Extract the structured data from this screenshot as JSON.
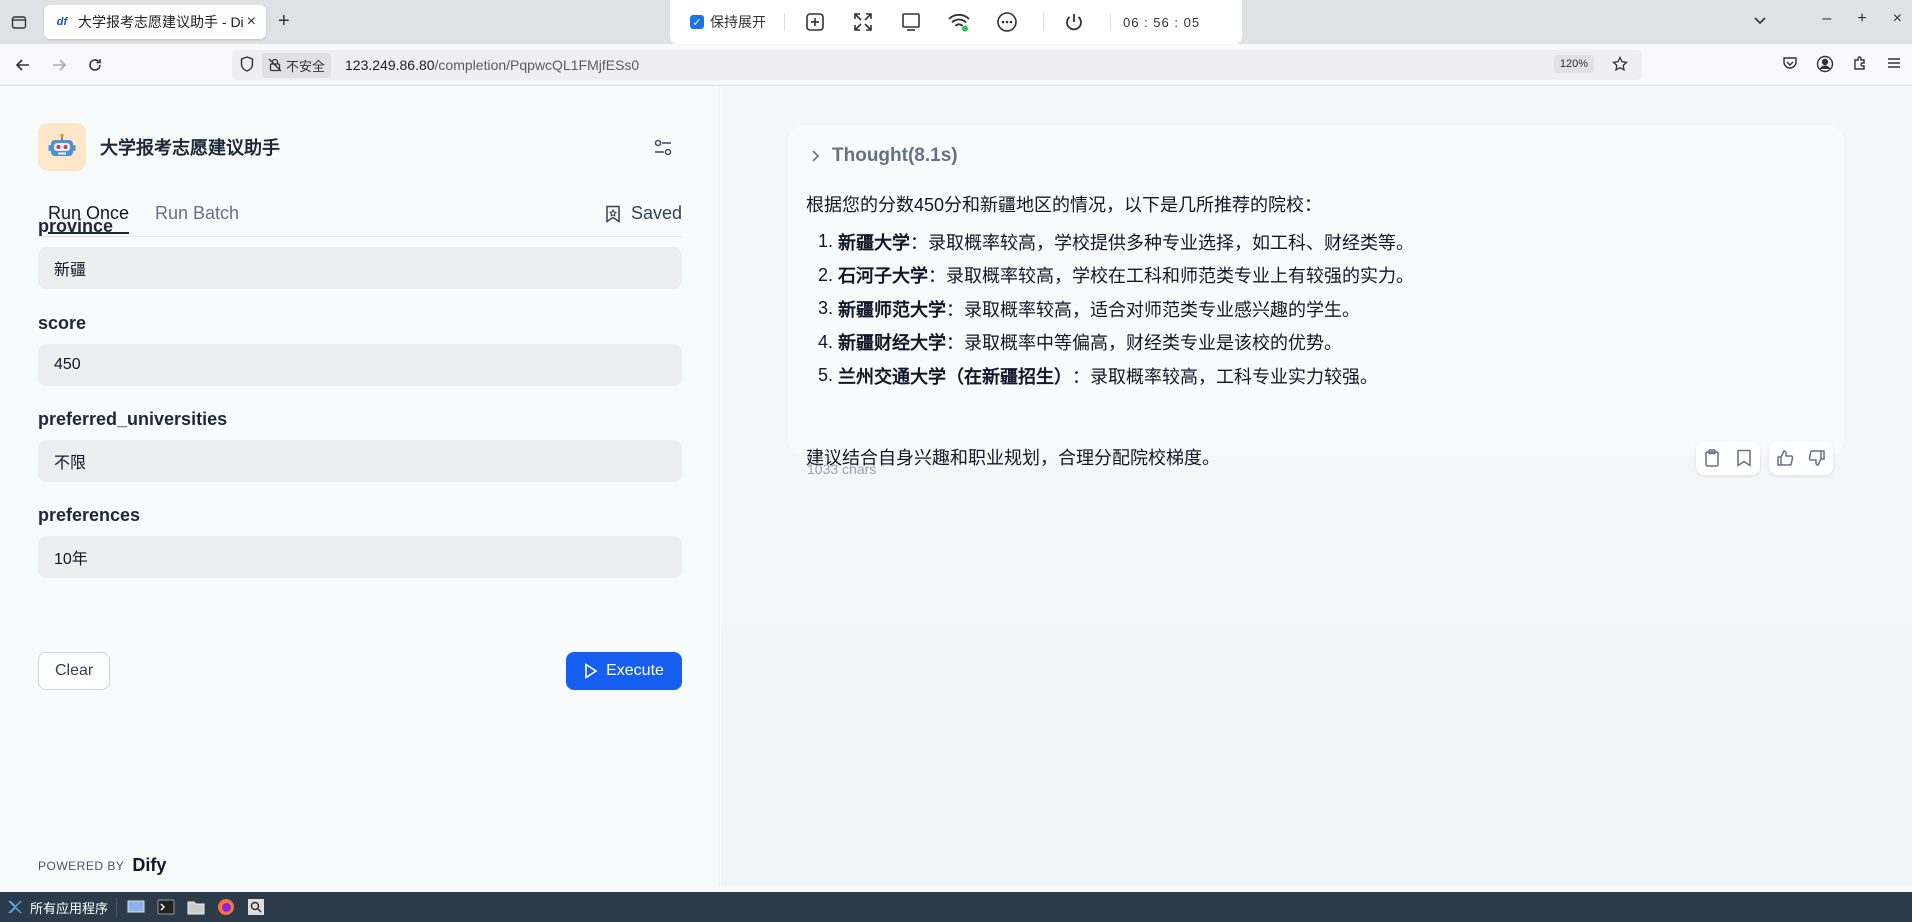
{
  "browser": {
    "tab_title": "大学报考志愿建议助手 - Dify",
    "favicon": "Dify-icon",
    "remote_toolbar": {
      "keep_expanded": "保持展开",
      "clock": "06 : 56 : 05"
    },
    "insecure_label": "不安全",
    "url_host": "123.249.86.80",
    "url_path": "/completion/PqpwcQL1FMjfESs0",
    "zoom": "120%"
  },
  "app": {
    "name": "大学报考志愿建议助手",
    "tabs": {
      "run_once": "Run Once",
      "run_batch": "Run Batch",
      "saved": "Saved"
    },
    "fields": [
      {
        "label": "province",
        "value": "新疆"
      },
      {
        "label": "score",
        "value": "450"
      },
      {
        "label": "preferred_universities",
        "value": "不限"
      },
      {
        "label": "preferences",
        "value": "10年"
      }
    ],
    "clear_label": "Clear",
    "execute_label": "Execute",
    "powered_by": "POWERED BY",
    "brand": "Dify"
  },
  "result": {
    "thought": "Thought(8.1s)",
    "intro": "根据您的分数450分和新疆地区的情况，以下是几所推荐的院校：",
    "items": [
      {
        "num": "1.",
        "name": "新疆大学",
        "desc": "：录取概率较高，学校提供多种专业选择，如工科、财经类等。"
      },
      {
        "num": "2.",
        "name": "石河子大学",
        "desc": "：录取概率较高，学校在工科和师范类专业上有较强的实力。"
      },
      {
        "num": "3.",
        "name": "新疆师范大学",
        "desc": "：录取概率较高，适合对师范类专业感兴趣的学生。"
      },
      {
        "num": "4.",
        "name": "新疆财经大学",
        "desc": "：录取概率中等偏高，财经类专业是该校的优势。"
      },
      {
        "num": "5.",
        "name": "兰州交通大学（在新疆招生）",
        "desc": "：录取概率较高，工科专业实力较强。"
      }
    ],
    "outro": "建议结合自身兴趣和职业规划，合理分配院校梯度。",
    "chars": "1033 chars"
  },
  "taskbar": {
    "start_label": "所有应用程序"
  },
  "colors": {
    "primary": "#155eef",
    "text": "#101828",
    "muted": "#667085"
  }
}
